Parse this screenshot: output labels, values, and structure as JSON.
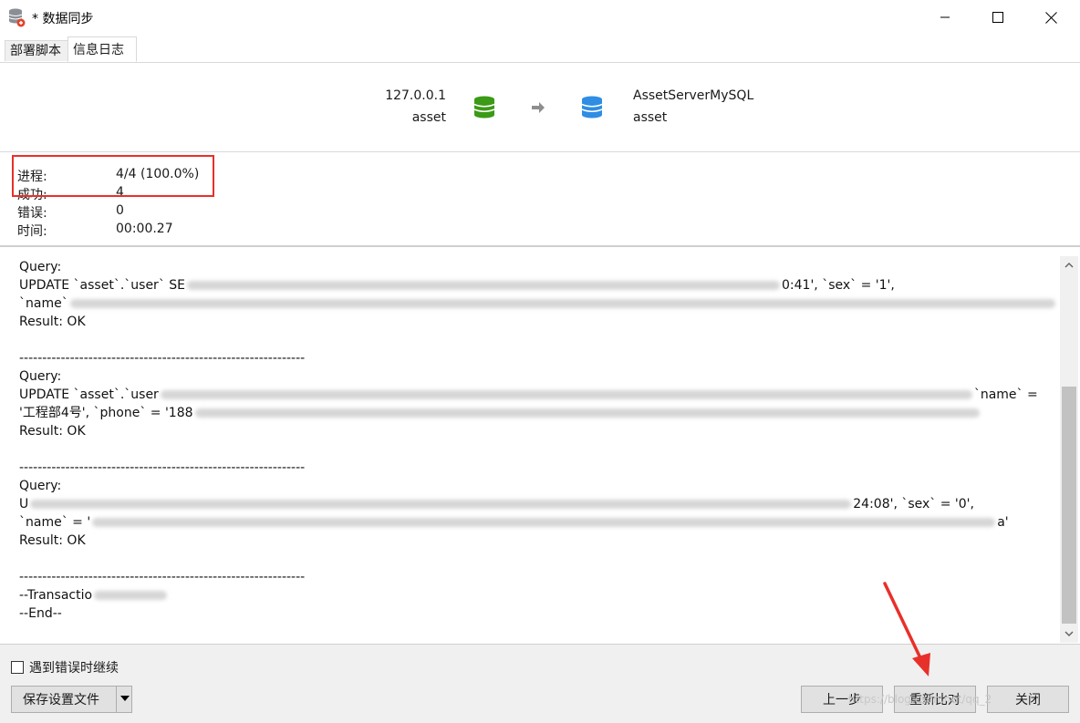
{
  "window": {
    "title": "* 数据同步",
    "icons": {
      "app": "database-sync-icon",
      "minimize": "minimize-icon",
      "maximize": "maximize-icon",
      "close": "close-icon"
    }
  },
  "tabs": [
    {
      "label": "部署脚本",
      "active": false
    },
    {
      "label": "信息日志",
      "active": true
    }
  ],
  "connection": {
    "source": {
      "host": "127.0.0.1",
      "database": "asset",
      "icon": "database-green-icon"
    },
    "target": {
      "host": "AssetServerMySQL",
      "database": "asset",
      "icon": "database-blue-icon"
    },
    "arrow_icon": "arrow-right-icon"
  },
  "stats": {
    "progress": {
      "label": "进程:",
      "value": "4/4 (100.0%)",
      "fraction": 1.0
    },
    "success": {
      "label": "成功:",
      "value": "4"
    },
    "errors": {
      "label": "错误:",
      "value": "0"
    },
    "time": {
      "label": "时间:",
      "value": "00:00.27"
    }
  },
  "log": {
    "entries": [
      {
        "query_label": "Query:",
        "line1": {
          "start": "UPDATE `asset`.`user` SE",
          "end": "0:41', `sex` = '1',"
        },
        "line2": {
          "start": "`name`",
          "end": ""
        },
        "result": "Result: OK"
      },
      {
        "query_label": "Query:",
        "line1": {
          "start": "UPDATE `asset`.`user",
          "end": "`name` ="
        },
        "line2": {
          "start": "'工程部4号', `phone` = '188",
          "end": ""
        },
        "result": "Result: OK"
      },
      {
        "query_label": "Query:",
        "line1": {
          "start": "U",
          "end": "24:08', `sex` = '0',"
        },
        "line2": {
          "start": "`name` = '",
          "end": "a'"
        },
        "result": "Result: OK"
      }
    ],
    "separator": "--------------------------------------------------------------",
    "transaction": "--Transactio",
    "end": "--End--"
  },
  "bottom": {
    "continue_on_error": {
      "label": "遇到错误时继续",
      "checked": false
    },
    "save_settings_label": "保存设置文件",
    "prev_label": "上一步",
    "recompare_label": "重新比对",
    "close_label": "关闭"
  },
  "watermark": "https://blog.csdn.net/qq_2"
}
